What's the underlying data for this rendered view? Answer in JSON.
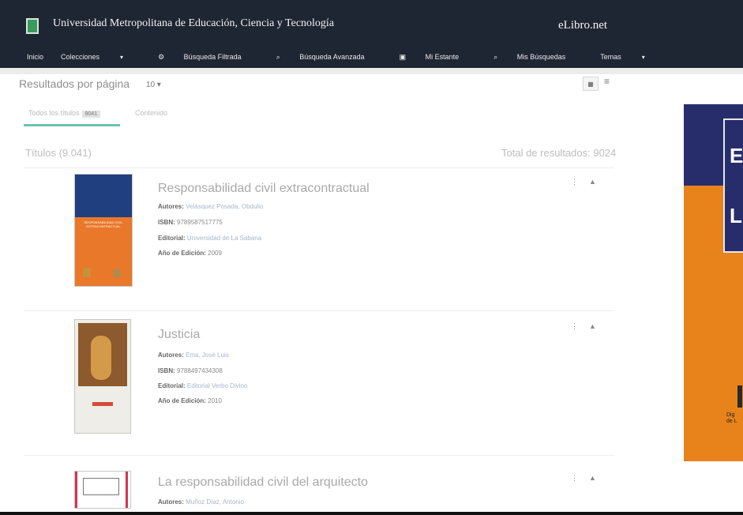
{
  "header": {
    "institution": "Universidad Metropolitana de Educación, Ciencia y Tecnología",
    "brand": "eLibro.net",
    "nav": [
      "Inicio",
      "Colecciones",
      "Búsqueda Filtrada",
      "Búsqueda Avanzada",
      "Mi Estante",
      "Mis Búsquedas",
      "Temas"
    ]
  },
  "toolbar": {
    "results_per_page_label": "Resultados por página",
    "per_page_value": "10"
  },
  "tabs": [
    {
      "label": "Todos los títulos",
      "badge": "9041"
    },
    {
      "label": "Contenido"
    }
  ],
  "summary": {
    "titles_count": "Títulos (9.041)",
    "total_results": "Total de resultados: 9024"
  },
  "results": [
    {
      "title": "Responsabilidad civil extracontractual",
      "author": "Velásquez Posada, Obdulio",
      "isbn": "9789587517775",
      "publisher": "Universidad de La Sabana",
      "year": "2009",
      "cover_title": "RESPONSABILIDAD CIVIL EXTRACONTRACTUAL"
    },
    {
      "title": "Justicia",
      "author": "Ema, José Luis",
      "isbn": "9788497434308",
      "publisher": "Editorial Verbo Divino",
      "year": "2010",
      "cover_title": "Justicia"
    },
    {
      "title": "La responsabilidad civil del arquitecto",
      "author": "Muñoz Díaz, Antonio"
    }
  ],
  "labels": {
    "authors": "Autores:",
    "isbn": "ISBN:",
    "publisher": "Editorial:",
    "year": "Año de Edición:"
  },
  "ad": {
    "letters": [
      "E",
      "L"
    ],
    "small_text": "Dig\nde L"
  }
}
